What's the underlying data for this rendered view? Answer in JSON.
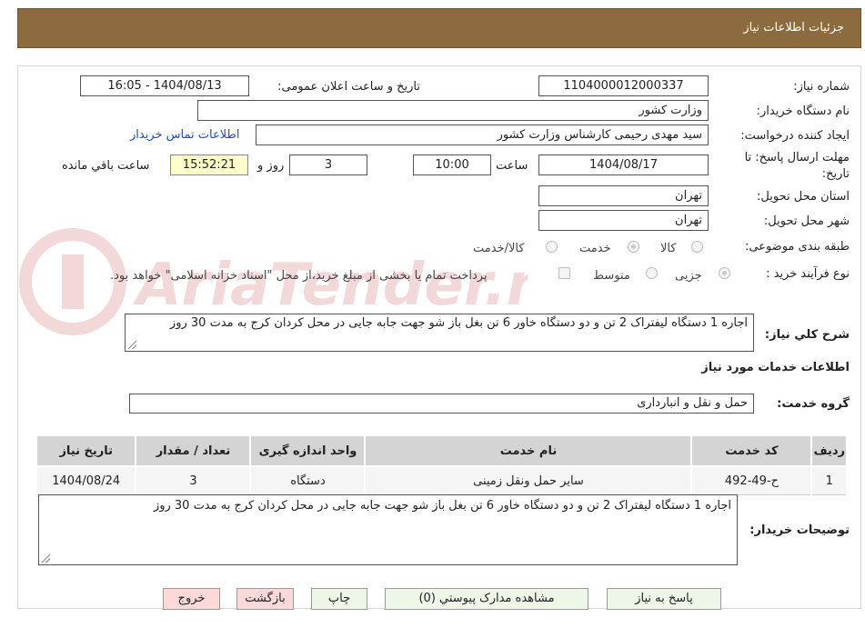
{
  "header": {
    "title": "جزئیات اطلاعات نیاز"
  },
  "form": {
    "need_number_label": "شماره نیاز:",
    "need_number": "1104000012000337",
    "announce_label": "تاریخ و ساعت اعلان عمومی:",
    "announce_value": "1404/08/13 - 16:05",
    "buyer_org_label": "نام دستگاه خریدار:",
    "buyer_org": "وزارت کشور",
    "creator_label": "ایجاد کننده درخواست:",
    "creator": "سید مهدی رحیمی کارشناس وزارت کشور",
    "contact_link": "اطلاعات تماس خریدار",
    "deadline_label_1": "مهلت ارسال پاسخ: تا",
    "deadline_label_2": "تاریخ:",
    "deadline_date": "1404/08/17",
    "hour_label": "ساعت",
    "deadline_time": "10:00",
    "days_value": "3",
    "days_label": "روز و",
    "remaining_time": "15:52:21",
    "remaining_label": "ساعت باقي مانده",
    "province_label": "استان محل تحویل:",
    "province": "تهران",
    "city_label": "شهر محل تحویل:",
    "city": "تهران",
    "category_label": "طبقه بندی موضوعی:",
    "category_options": [
      "کالا",
      "خدمت",
      "کالا/خدمت"
    ],
    "process_label": "نوع فرآیند خرید :",
    "process_options": [
      "جزیی",
      "متوسط"
    ],
    "payment_note": "پرداخت تمام یا بخشی از مبلغ خرید،از محل \"اسناد خزانه اسلامی\" خواهد بود.",
    "summary_label": "شرح کلي نياز:",
    "summary": "اجاره 1 دستگاه لیفتراک 2 تن و دو دستگاه خاور 6 تن بغل باز شو جهت جابه جایی در محل کردان کرج به مدت 30 روز"
  },
  "services": {
    "section_title": "اطلاعات خدمات مورد نیاز",
    "group_label": "گروه خدمت:",
    "group_value": "حمل و نقل و انبارداری",
    "columns": [
      "ردیف",
      "کد خدمت",
      "نام خدمت",
      "واحد اندازه گیری",
      "تعداد / مقدار",
      "تاریخ نیاز"
    ],
    "rows": [
      [
        "1",
        "ح-49-492",
        "سایر حمل ونقل زمینی",
        "دستگاه",
        "3",
        "1404/08/24"
      ]
    ]
  },
  "buyer_notes": {
    "label": "توضیحات خریدار:",
    "text": "اجاره 1 دستگاه لیفتراک 2 تن و دو دستگاه خاور 6 تن بغل باز شو  جهت جابه جایی در محل کردان کرج به مدت 30 روز"
  },
  "buttons": {
    "reply": "پاسخ به نیاز",
    "attachments": "مشاهده مدارک پیوستي (0)",
    "print": "چاپ",
    "back": "بازگشت",
    "exit": "خروج"
  },
  "watermark": {
    "text": "AriaTender.neT"
  },
  "colors": {
    "header_bg": "#8c6b3f",
    "link": "#1f4fb0",
    "time_bg": "#ffffcc"
  }
}
